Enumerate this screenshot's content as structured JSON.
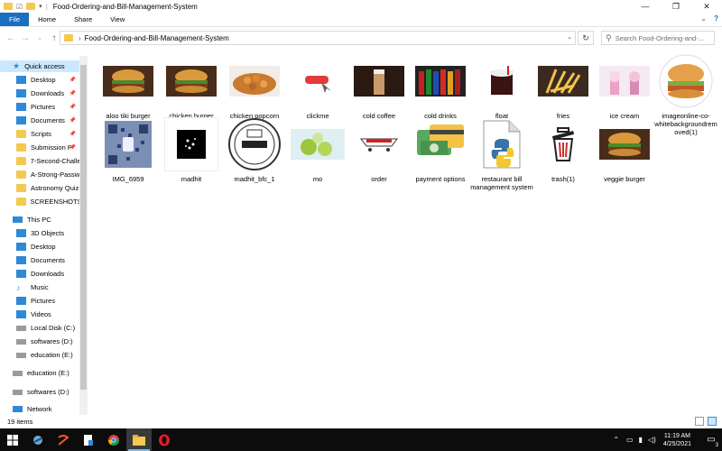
{
  "window": {
    "title": "Food-Ordering-and-Bill-Management-System",
    "controls": [
      "minimize",
      "maximize",
      "close"
    ]
  },
  "ribbon": {
    "tabs": [
      "File",
      "Home",
      "Share",
      "View"
    ]
  },
  "address": {
    "path": "Food-Ordering-and-Bill-Management-System",
    "search_placeholder": "Search Food-Ordering-and-..."
  },
  "nav": {
    "quick_access_label": "Quick access",
    "quick_items": [
      {
        "label": "Desktop",
        "icon": "desktop-icon",
        "pinned": true
      },
      {
        "label": "Downloads",
        "icon": "downloads-icon",
        "pinned": true
      },
      {
        "label": "Pictures",
        "icon": "pictures-icon",
        "pinned": true
      },
      {
        "label": "Documents",
        "icon": "documents-icon",
        "pinned": true
      },
      {
        "label": "Scripts",
        "icon": "folder-icon",
        "pinned": true
      },
      {
        "label": "Submission P",
        "icon": "folder-icon",
        "pinned": true
      },
      {
        "label": "7-Second-Challe",
        "icon": "folder-icon",
        "pinned": false
      },
      {
        "label": "A-Strong-Passw",
        "icon": "folder-icon",
        "pinned": false
      },
      {
        "label": "Astronomy Quiz",
        "icon": "folder-icon",
        "pinned": false
      },
      {
        "label": "SCREENSHOTS",
        "icon": "folder-icon",
        "pinned": false
      }
    ],
    "this_pc_label": "This PC",
    "pc_items": [
      {
        "label": "3D Objects",
        "icon": "3d-objects-icon"
      },
      {
        "label": "Desktop",
        "icon": "desktop-icon"
      },
      {
        "label": "Documents",
        "icon": "documents-icon"
      },
      {
        "label": "Downloads",
        "icon": "downloads-icon"
      },
      {
        "label": "Music",
        "icon": "music-icon"
      },
      {
        "label": "Pictures",
        "icon": "pictures-icon"
      },
      {
        "label": "Videos",
        "icon": "videos-icon"
      },
      {
        "label": "Local Disk (C:)",
        "icon": "drive-icon"
      },
      {
        "label": "softwares (D:)",
        "icon": "drive-icon"
      },
      {
        "label": "education (E:)",
        "icon": "drive-icon"
      }
    ],
    "extra_drives": [
      "education (E:)",
      "softwares (D:)"
    ],
    "network_label": "Network"
  },
  "files": [
    {
      "name": "aloo tiki burger",
      "thumb": "burger"
    },
    {
      "name": "chicken burger",
      "thumb": "burger"
    },
    {
      "name": "chicken popcorn",
      "thumb": "popcorn"
    },
    {
      "name": "clickme",
      "thumb": "button"
    },
    {
      "name": "cold coffee",
      "thumb": "coffee"
    },
    {
      "name": "cold drinks",
      "thumb": "drinks"
    },
    {
      "name": "float",
      "thumb": "float"
    },
    {
      "name": "fries",
      "thumb": "fries"
    },
    {
      "name": "ice cream",
      "thumb": "icecream"
    },
    {
      "name": "imageonline-co-whitebackgroundremoved(1)",
      "thumb": "burger-round"
    },
    {
      "name": "IMG_6959",
      "thumb": "qr"
    },
    {
      "name": "madhit",
      "thumb": "dark-logo"
    },
    {
      "name": "madhit_bfc_1",
      "thumb": "round-logo"
    },
    {
      "name": "mo",
      "thumb": "lime"
    },
    {
      "name": "order",
      "thumb": "order"
    },
    {
      "name": "payment options",
      "thumb": "payment"
    },
    {
      "name": "restaurant bill management system",
      "thumb": "python"
    },
    {
      "name": "trash(1)",
      "thumb": "trash"
    },
    {
      "name": "veggie burger",
      "thumb": "burger"
    }
  ],
  "status": {
    "item_count": "19 items"
  },
  "taskbar": {
    "time": "11:19 AM",
    "date": "4/25/2021",
    "notification_count": "3",
    "apps": [
      "start-icon",
      "search-icon",
      "taskview-icon",
      "files-icon",
      "chrome-icon",
      "file-explorer-icon",
      "opera-icon"
    ]
  }
}
